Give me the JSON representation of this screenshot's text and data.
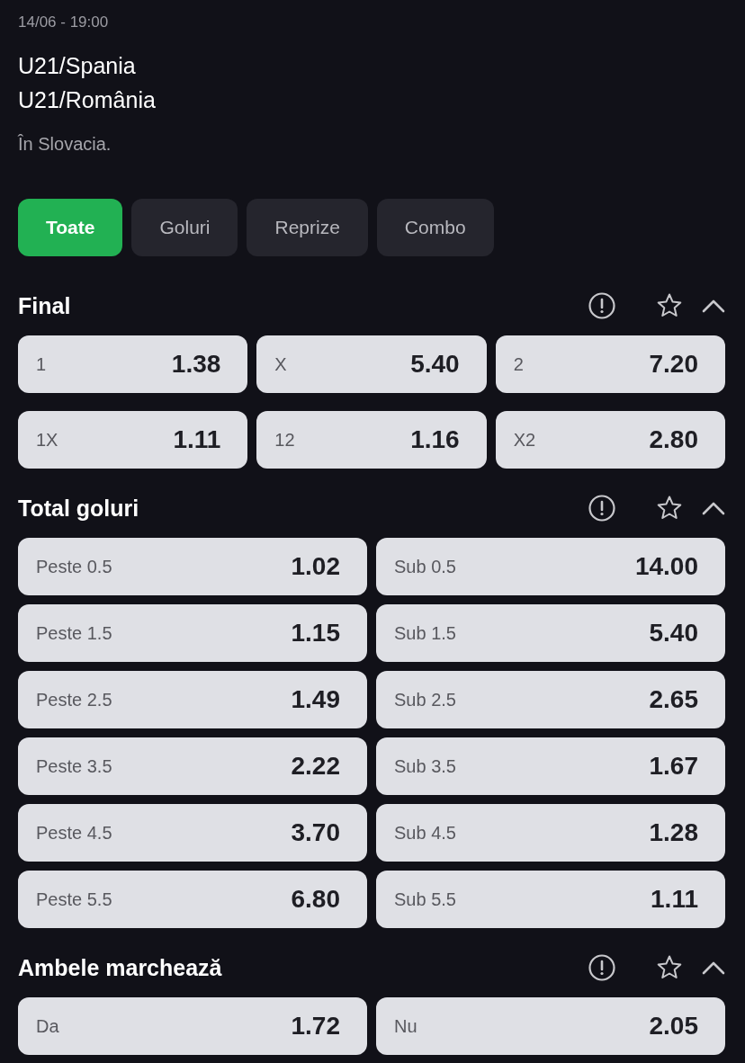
{
  "match": {
    "datetime": "14/06 - 19:00",
    "teams": [
      "U21/Spania",
      "U21/România"
    ],
    "venue": "În Slovacia."
  },
  "tabs": [
    {
      "label": "Toate",
      "selected": true
    },
    {
      "label": "Goluri",
      "selected": false
    },
    {
      "label": "Reprize",
      "selected": false
    },
    {
      "label": "Combo",
      "selected": false
    }
  ],
  "markets": [
    {
      "title": "Final",
      "kind": "triple",
      "favorite": false,
      "expanded": true,
      "selections": [
        {
          "label": "1",
          "odds": "1.38",
          "selected": false
        },
        {
          "label": "X",
          "odds": "5.40",
          "selected": false
        },
        {
          "label": "2",
          "odds": "7.20",
          "selected": false
        },
        {
          "label": "1X",
          "odds": "1.11",
          "selected": false
        },
        {
          "label": "12",
          "odds": "1.16",
          "selected": false
        },
        {
          "label": "X2",
          "odds": "2.80",
          "selected": false
        }
      ]
    },
    {
      "title": "Total goluri",
      "kind": "double",
      "favorite": false,
      "expanded": true,
      "selections": [
        {
          "label": "Peste 0.5",
          "odds": "1.02",
          "selected": false
        },
        {
          "label": "Sub 0.5",
          "odds": "14.00",
          "selected": false
        },
        {
          "label": "Peste 1.5",
          "odds": "1.15",
          "selected": false
        },
        {
          "label": "Sub 1.5",
          "odds": "5.40",
          "selected": false
        },
        {
          "label": "Peste 2.5",
          "odds": "1.49",
          "selected": false
        },
        {
          "label": "Sub 2.5",
          "odds": "2.65",
          "selected": false
        },
        {
          "label": "Peste 3.5",
          "odds": "2.22",
          "selected": false
        },
        {
          "label": "Sub 3.5",
          "odds": "1.67",
          "selected": false
        },
        {
          "label": "Peste 4.5",
          "odds": "3.70",
          "selected": false
        },
        {
          "label": "Sub 4.5",
          "odds": "1.28",
          "selected": false
        },
        {
          "label": "Peste 5.5",
          "odds": "6.80",
          "selected": false
        },
        {
          "label": "Sub 5.5",
          "odds": "1.11",
          "selected": false
        }
      ]
    },
    {
      "title": "Ambele marchează",
      "kind": "double",
      "favorite": false,
      "expanded": true,
      "selections": [
        {
          "label": "Da",
          "odds": "1.72",
          "selected": false
        },
        {
          "label": "Nu",
          "odds": "2.05",
          "selected": false
        }
      ]
    }
  ]
}
